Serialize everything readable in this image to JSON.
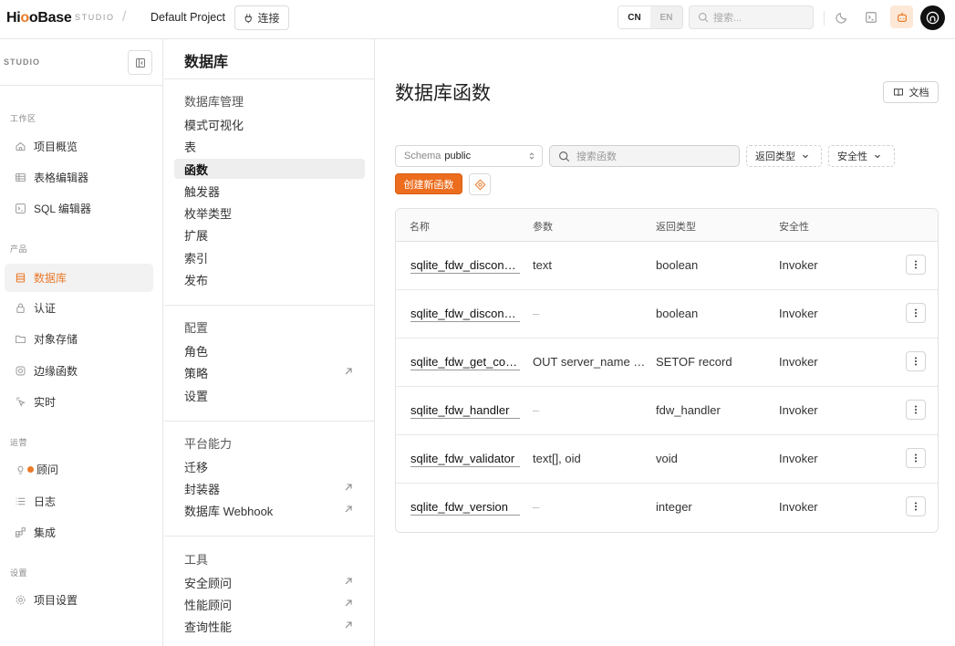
{
  "header": {
    "logo": {
      "part1": "Hi",
      "part2": "o",
      "part3": "oBase"
    },
    "studio_label": "STUDIO",
    "separator": "/",
    "project": "Default Project",
    "connect_label": "连接",
    "lang_cn": "CN",
    "lang_en": "EN",
    "search_placeholder": "搜索..."
  },
  "sidebar": {
    "studio_label": "STUDIO",
    "sections": {
      "workspace": "工作区",
      "product": "产品",
      "ops": "运营",
      "settings": "设置"
    },
    "items": {
      "overview": "项目概览",
      "table_editor": "表格编辑器",
      "sql_editor": "SQL 编辑器",
      "database": "数据库",
      "auth": "认证",
      "storage": "对象存储",
      "edge_functions": "边缘函数",
      "realtime": "实时",
      "advisor": "顾问",
      "logs": "日志",
      "integrations": "集成",
      "project_settings": "项目设置"
    }
  },
  "submenu": {
    "title": "数据库",
    "group_manage": "数据库管理",
    "items_manage": [
      "模式可视化",
      "表",
      "函数",
      "触发器",
      "枚举类型",
      "扩展",
      "索引",
      "发布"
    ],
    "group_config": "配置",
    "items_config": [
      "角色",
      "策略",
      "设置"
    ],
    "group_platform": "平台能力",
    "items_platform": [
      "迁移",
      "封装器",
      "数据库 Webhook"
    ],
    "group_tools": "工具",
    "items_tools": [
      "安全顾问",
      "性能顾问",
      "查询性能"
    ]
  },
  "main": {
    "title": "数据库函数",
    "docs_label": "文档",
    "schema_label": "Schema",
    "schema_value": "public",
    "search_placeholder": "搜索函数",
    "filter_return": "返回类型",
    "filter_security": "安全性",
    "create_label": "创建新函数",
    "columns": [
      "名称",
      "参数",
      "返回类型",
      "安全性"
    ],
    "rows": [
      {
        "name": "sqlite_fdw_disconnect",
        "args": "text",
        "ret": "boolean",
        "sec": "Invoker"
      },
      {
        "name": "sqlite_fdw_disconnect_all",
        "args": "–",
        "ret": "boolean",
        "sec": "Invoker"
      },
      {
        "name": "sqlite_fdw_get_connections",
        "args": "OUT server_name text, OUT valid boolean",
        "ret": "SETOF record",
        "sec": "Invoker"
      },
      {
        "name": "sqlite_fdw_handler",
        "args": "–",
        "ret": "fdw_handler",
        "sec": "Invoker"
      },
      {
        "name": "sqlite_fdw_validator",
        "args": "text[], oid",
        "ret": "void",
        "sec": "Invoker"
      },
      {
        "name": "sqlite_fdw_version",
        "args": "–",
        "ret": "integer",
        "sec": "Invoker"
      }
    ]
  },
  "colors": {
    "accent": "#ea7a2a",
    "button": "#ec6d1e"
  }
}
